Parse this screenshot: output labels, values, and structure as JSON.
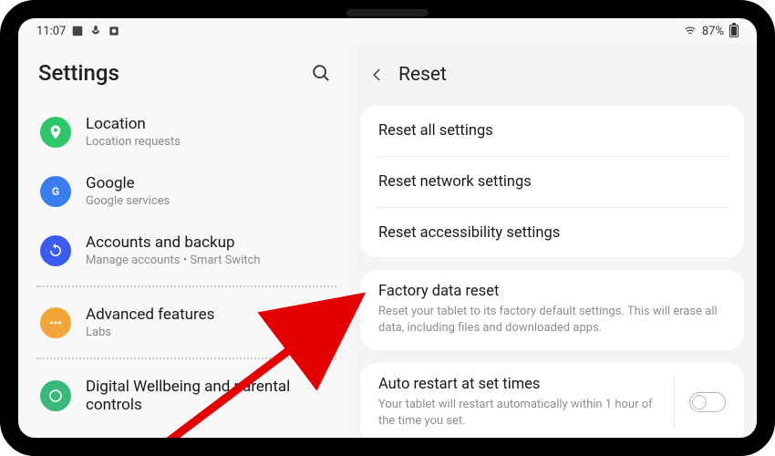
{
  "status_bar": {
    "time": "11:07",
    "battery_pct": "87%"
  },
  "left": {
    "title": "Settings",
    "items": [
      {
        "icon": "location",
        "color": "#2ec66a",
        "title": "Location",
        "subtitle": "Location requests"
      },
      {
        "icon": "google",
        "color": "#3a7df0",
        "title": "Google",
        "subtitle": "Google services"
      },
      {
        "icon": "sync",
        "color": "#3a5cf0",
        "title": "Accounts and backup",
        "subtitle": "Manage accounts  •  Smart Switch"
      },
      {
        "icon": "dots",
        "color": "#f2a63a",
        "title": "Advanced features",
        "subtitle": "Labs"
      },
      {
        "icon": "wellbeing",
        "color": "#39b879",
        "title": "Digital Wellbeing and parental controls",
        "subtitle": ""
      }
    ]
  },
  "right": {
    "title": "Reset",
    "group1": [
      {
        "title": "Reset all settings"
      },
      {
        "title": "Reset network settings"
      },
      {
        "title": "Reset accessibility settings"
      }
    ],
    "group2": {
      "title": "Factory data reset",
      "desc": "Reset your tablet to its factory default settings. This will erase all data, including files and downloaded apps."
    },
    "group3": {
      "title": "Auto restart at set times",
      "desc": "Your tablet will restart automatically within 1 hour of the time you set."
    }
  }
}
